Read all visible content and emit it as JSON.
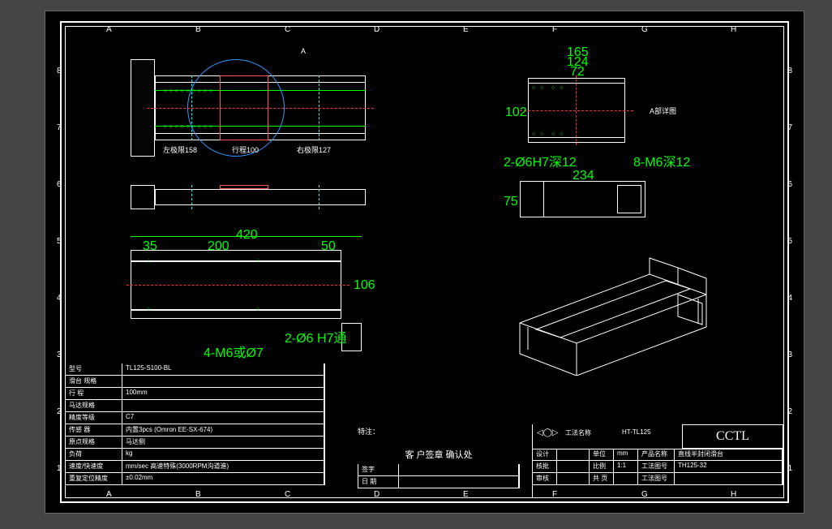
{
  "columns": [
    "A",
    "B",
    "C",
    "D",
    "E",
    "F",
    "G",
    "H"
  ],
  "rows": [
    "1",
    "2",
    "3",
    "4",
    "5",
    "6",
    "7",
    "8"
  ],
  "view_labels": {
    "detail_a": "A",
    "detail_title": "A部详图",
    "left_limit": "左极限158",
    "stroke": "行程100",
    "right_limit": "右极限127"
  },
  "dimensions": {
    "d165": "165",
    "d124": "124",
    "d72": "72",
    "d102": "102",
    "d234": "234",
    "d75": "75",
    "d420": "420",
    "d35": "35",
    "d200": "200",
    "d50": "50",
    "d106": "106",
    "note1": "2-Ø6H7深12",
    "note2": "8-M6深12",
    "note3": "2-Ø6 H7通",
    "note4": "4-M6或Ø7"
  },
  "titleblock": {
    "company": "CCTL",
    "model_label": "型号",
    "model": "TL125-S100-BL",
    "subtype_label": "滑台 规格",
    "stroke_label": "行 程",
    "stroke": "100mm",
    "motor_label": "马达规格",
    "grade_label": "精度等级",
    "grade": "C7",
    "sensor_label": "传感 器",
    "sensor": "内置3pcs (Omron EE-SX-674)",
    "origin_label": "原点规格",
    "origin": "马达侧",
    "load_label": "负荷",
    "load": "kg",
    "speed_label": "速度/快速度",
    "speed": "mm/sec 高速特殊(3000RPM沟道進)",
    "repeat_label": "重复定位精度",
    "repeat": "±0.02mm",
    "notes_label": "特注：",
    "sign_label": "客 户签章 确认处",
    "sign_name": "签字",
    "sign_date": "日 期",
    "eye_icon": "◁◯▷",
    "proj_label": "工法名称",
    "proj_val": "HT-TL125",
    "unit_label": "单位",
    "unit": "mm",
    "prod_label": "产品名称",
    "prod": "直线半封闭滑台",
    "ratio_label": "比例",
    "ratio": "1:1",
    "drawno_label": "工法图号",
    "drawno": "TH125-32",
    "page_label": "工法图号",
    "design_label": "设计",
    "check_label": "核批",
    "approve_label": "审核",
    "date_label": "日期",
    "total_label": "共 页"
  }
}
